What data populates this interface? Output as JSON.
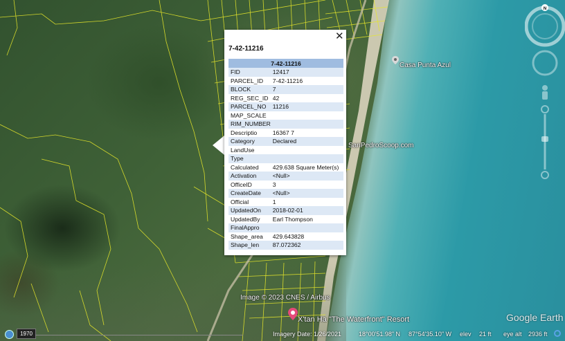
{
  "map": {
    "labels": {
      "place_casa": "Casa Punta Azul",
      "place_scoop": "SanPedroScoop.com",
      "place_resort": "X'tan Ha \"The Waterfront\" Resort",
      "copyright": "Image © 2023 CNES / Airbus"
    },
    "brand": "Google Earth",
    "colors": {
      "parcel_lines": "#e6e62a",
      "popup_header": "#9fbce0",
      "popup_row_alt": "#dde8f5",
      "pin_pink": "#e64a7a"
    }
  },
  "popup": {
    "title": "7-42-11216",
    "header": "7-42-11216",
    "close_label": "✕",
    "rows": [
      {
        "key": "FID",
        "value": "12417"
      },
      {
        "key": "PARCEL_ID",
        "value": "7-42-11216"
      },
      {
        "key": "BLOCK",
        "value": "7"
      },
      {
        "key": "REG_SEC_ID",
        "value": "42"
      },
      {
        "key": "PARCEL_NO",
        "value": "11216"
      },
      {
        "key": "MAP_SCALE",
        "value": ""
      },
      {
        "key": "RIM_NUMBER",
        "value": ""
      },
      {
        "key": "Descriptio",
        "value": "16367 7"
      },
      {
        "key": "Category",
        "value": "Declared"
      },
      {
        "key": "LandUse",
        "value": ""
      },
      {
        "key": "Type",
        "value": ""
      },
      {
        "key": "Calculated",
        "value": "429.638 Square Meter(s)"
      },
      {
        "key": "Activation",
        "value": "<Null>"
      },
      {
        "key": "OfficeID",
        "value": "3"
      },
      {
        "key": "CreateDate",
        "value": "<Null>"
      },
      {
        "key": "Official",
        "value": "1"
      },
      {
        "key": "UpdatedOn",
        "value": "2018-02-01"
      },
      {
        "key": "UpdatedBy",
        "value": "Earl Thompson"
      },
      {
        "key": "FinalAppro",
        "value": ""
      },
      {
        "key": "Shape_area",
        "value": "429.643828"
      },
      {
        "key": "Shape_len",
        "value": "87.072362"
      }
    ]
  },
  "nav": {
    "north_label": "N"
  },
  "status": {
    "year": "1970",
    "imagery_date": "Imagery Date: 1/26/2021",
    "lat": "18°00'51.98\" N",
    "lon": "87°54'35.10\" W",
    "elev_label": "elev",
    "elev_value": "21 ft",
    "eye_alt_label": "eye alt",
    "eye_alt_value": "2936 ft"
  }
}
